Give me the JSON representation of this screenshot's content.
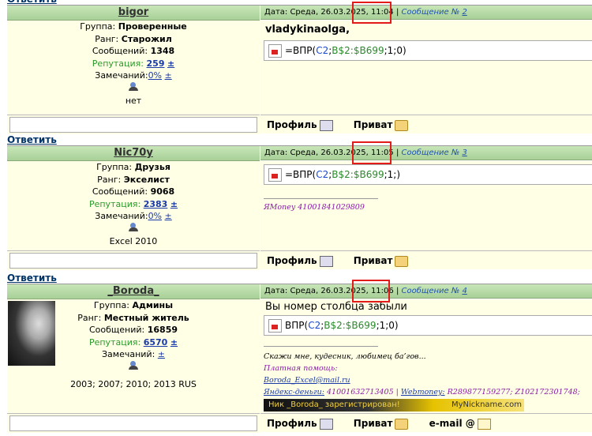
{
  "reply_label": "Ответить",
  "footer": {
    "profile": "Профиль",
    "private": "Приват",
    "email": "e-mail"
  },
  "labels": {
    "date": "Дата:",
    "message": "Сообщение №",
    "group": "Группа:",
    "rank": "Ранг:",
    "posts": "Сообщений:",
    "reputation": "Репутация:",
    "warnings": "Замечаний:",
    "plus": "±"
  },
  "posts": [
    {
      "author": "bigor",
      "date": "Среда, 26.03.2025, 11:04",
      "msg_no": "2",
      "group": "Проверенные",
      "rank": "Старожил",
      "posts": "1348",
      "reputation": "259",
      "warnings": "0%",
      "extra": "нет",
      "greeting": "vladykinaolga,",
      "formula": {
        "a": "=ВПР(",
        "b": "C2",
        "c": ";",
        "d": "B$2:$B699",
        "e": ";1;0)"
      }
    },
    {
      "author": "Nic70y",
      "date": "Среда, 26.03.2025, 11:05",
      "msg_no": "3",
      "group": "Друзья",
      "rank": "Экселист",
      "posts": "9068",
      "reputation": "2383",
      "warnings": "0%",
      "extra": "Excel 2010",
      "formula": {
        "a": "=ВПР(",
        "b": "C2",
        "c": ";",
        "d": "B$2:$B699",
        "e": ";1;)"
      },
      "signature": "ЯMoney 41001841029809"
    },
    {
      "author": "_Boroda_",
      "date": "Среда, 26.03.2025, 11:06",
      "msg_no": "4",
      "group": "Админы",
      "rank": "Местный житель",
      "posts": "16859",
      "reputation": "6570",
      "warnings": "",
      "extra": "2003; 2007; 2010; 2013 RUS",
      "text": "Вы номер столбца забыли",
      "formula": {
        "a": "ВПР(",
        "b": "C2",
        "c": ";",
        "d": "B$2:$B699",
        "e": ";1;0)"
      },
      "sig_line1": "Скажи мне, кудесник, любимец ба’гов...",
      "sig_line2": "Платная помощь:",
      "sig_email": "Boroda_Excel@mail.ru",
      "sig_yandex": "Яндекс-деньги:",
      "sig_yandex_val": " 41001632713405 | ",
      "sig_webmoney": "Webmoney:",
      "sig_webmoney_val": " R289877159277; Z102172301748;",
      "banner_text": "Ник _Boroda_ зарегистрирован!",
      "banner_site": "MyNickname.com"
    }
  ]
}
